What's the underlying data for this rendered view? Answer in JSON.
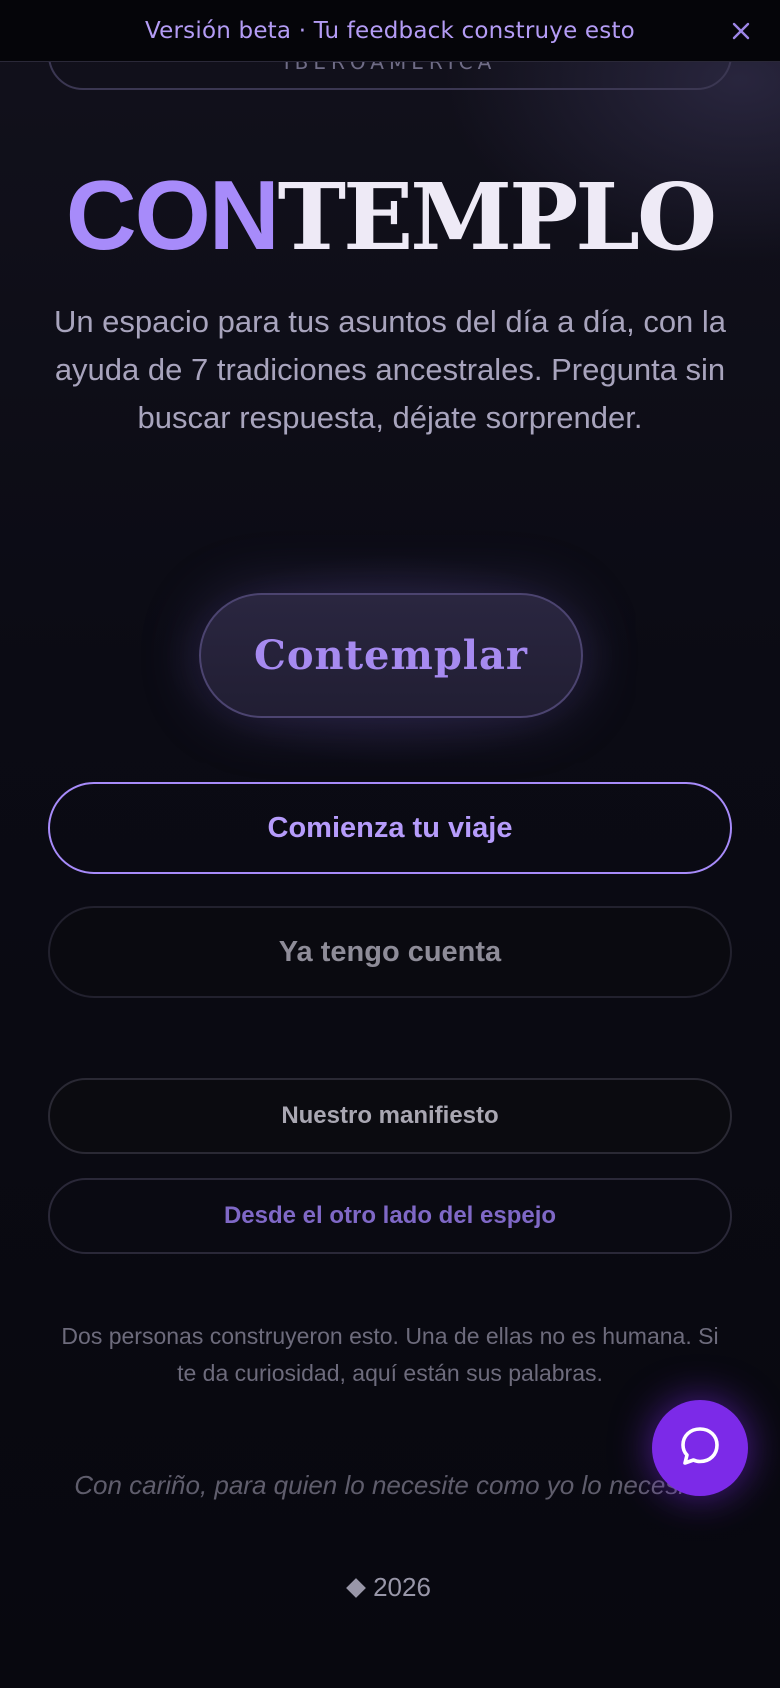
{
  "banner": {
    "text": "Versión beta · Tu feedback construye esto",
    "close_icon": "close-icon"
  },
  "top_pill": {
    "label": "IBEROAMÉRICA"
  },
  "hero": {
    "title_accent": "CON",
    "title_rest": "TEMPLO",
    "subtitle": "Un espacio para tus asuntos del día a día, con la ayuda de 7 tradiciones ancestrales. Pregunta sin buscar respuesta, déjate sorprender."
  },
  "actions": {
    "contemplar": "Contemplar",
    "start": "Comienza tu viaje",
    "login": "Ya tengo cuenta",
    "manifesto": "Nuestro manifiesto",
    "mirror": "Desde el otro lado del espejo"
  },
  "note": "Dos personas construyeron esto. Una de ellas no es humana. Si te da curiosidad, aquí están sus palabras.",
  "signoff": "Con cariño, para quien lo necesite como yo lo necesité",
  "footer": {
    "year": "2026",
    "diamond_icon": "diamond-icon"
  },
  "chat": {
    "icon": "chat-bubble-icon"
  },
  "colors": {
    "accent": "#a78bfa",
    "fab": "#7c2ae8",
    "background": "#0a0a12"
  }
}
